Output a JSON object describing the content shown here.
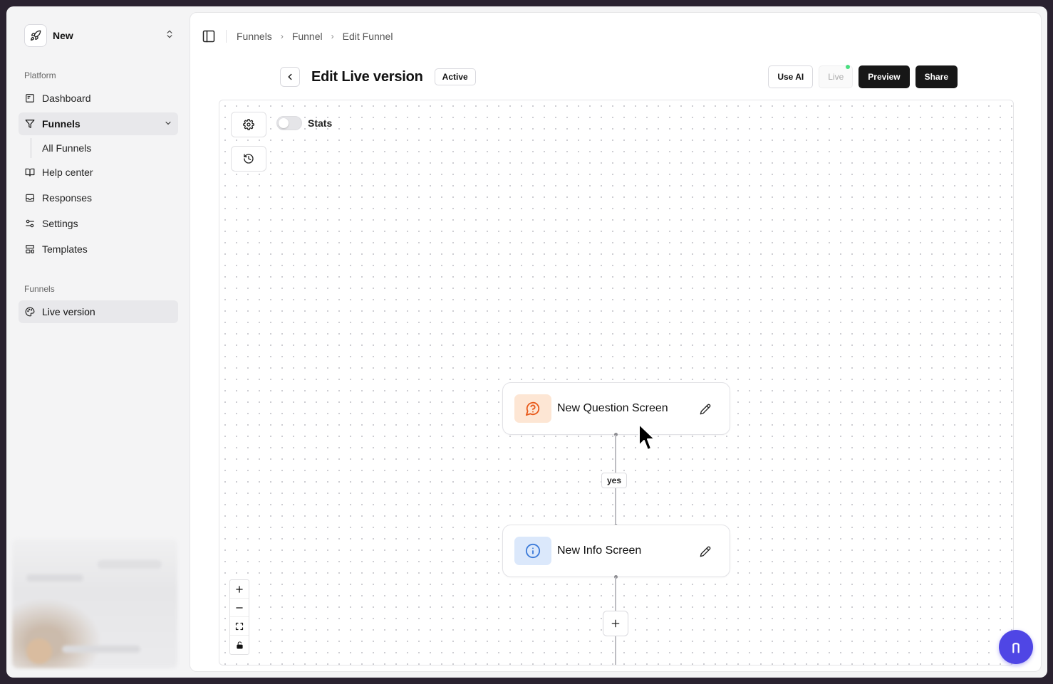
{
  "workspace": {
    "name": "New"
  },
  "sidebar": {
    "platform_label": "Platform",
    "items": [
      {
        "label": "Dashboard"
      },
      {
        "label": "Funnels"
      },
      {
        "label": "All Funnels"
      },
      {
        "label": "Help center"
      },
      {
        "label": "Responses"
      },
      {
        "label": "Settings"
      },
      {
        "label": "Templates"
      }
    ],
    "funnels_label": "Funnels",
    "funnel_items": [
      {
        "label": "Live version"
      }
    ]
  },
  "breadcrumb": [
    "Funnels",
    "Funnel",
    "Edit Funnel"
  ],
  "header": {
    "title": "Edit Live version",
    "status": "Active",
    "use_ai": "Use AI",
    "live": "Live",
    "preview": "Preview",
    "share": "Share"
  },
  "canvas": {
    "stats_label": "Stats",
    "stats_enabled": false,
    "nodes": [
      {
        "label": "New Question Screen",
        "icon": "question-bubble-icon",
        "color": "#fde6d4"
      },
      {
        "label": "New Info Screen",
        "icon": "info-icon",
        "color": "#dbe8fb"
      }
    ],
    "edge_label": "yes"
  },
  "colors": {
    "accent": "#4f46e5",
    "dark_button": "#171717",
    "live_dot": "#4ade80",
    "question_icon": "#e8591a",
    "info_icon": "#3b7ad9"
  }
}
